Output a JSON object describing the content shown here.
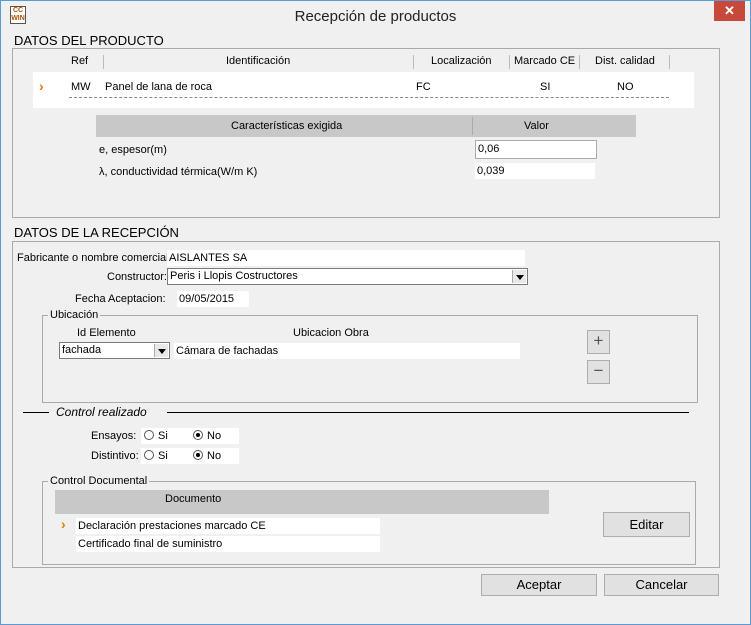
{
  "window": {
    "title": "Recepción de productos",
    "icon_text_top": "CC",
    "icon_text_bottom": "WIN",
    "close": "✕"
  },
  "producto": {
    "section_title": "DATOS DEL PRODUCTO",
    "columns": [
      "Ref",
      "Identificación",
      "Localización",
      "Marcado CE",
      "Dist. calidad"
    ],
    "row": {
      "ref": "MW",
      "identificacion": "Panel de lana de roca",
      "localizacion": "FC",
      "marcado_ce": "SI",
      "dist_calidad": "NO"
    },
    "caracteristicas_header": "Características exigida",
    "valor_header": "Valor",
    "caracteristicas": [
      {
        "label": "e, espesor(m)",
        "valor": "0,06"
      },
      {
        "label": "λ, conductividad térmica(W/m K)",
        "valor": "0,039"
      }
    ]
  },
  "recepcion": {
    "section_title": "DATOS DE LA RECEPCIÓN",
    "fabricante_label": "Fabricante o nombre comercial:",
    "fabricante_value": "AISLANTES SA",
    "constructor_label": "Constructor:",
    "constructor_value": "Peris i Llopis Costructores",
    "fecha_label": "Fecha Aceptacion:",
    "fecha_value": "09/05/2015",
    "ubicacion": {
      "group_title": "Ubicación",
      "id_elemento_label": "Id Elemento",
      "ubicacion_obra_label": "Ubicacion Obra",
      "id_elemento_value": "fachada",
      "ubicacion_obra_value": "Cámara de fachadas",
      "add_label": "+",
      "remove_label": "−"
    },
    "control": {
      "title": "Control realizado",
      "ensayos_label": "Ensayos:",
      "distintivo_label": "Distintivo:",
      "si_label": "Si",
      "no_label": "No"
    },
    "documental": {
      "group_title": "Control Documental",
      "documento_header": "Documento",
      "documentos": [
        "Declaración prestaciones marcado CE",
        "Certificado final de suministro"
      ],
      "editar_label": "Editar"
    }
  },
  "footer": {
    "aceptar": "Aceptar",
    "cancelar": "Cancelar"
  },
  "colors": {
    "close_red": "#c7493b",
    "selector_orange": "#e07a10",
    "header_gray": "#c8c8c8"
  }
}
